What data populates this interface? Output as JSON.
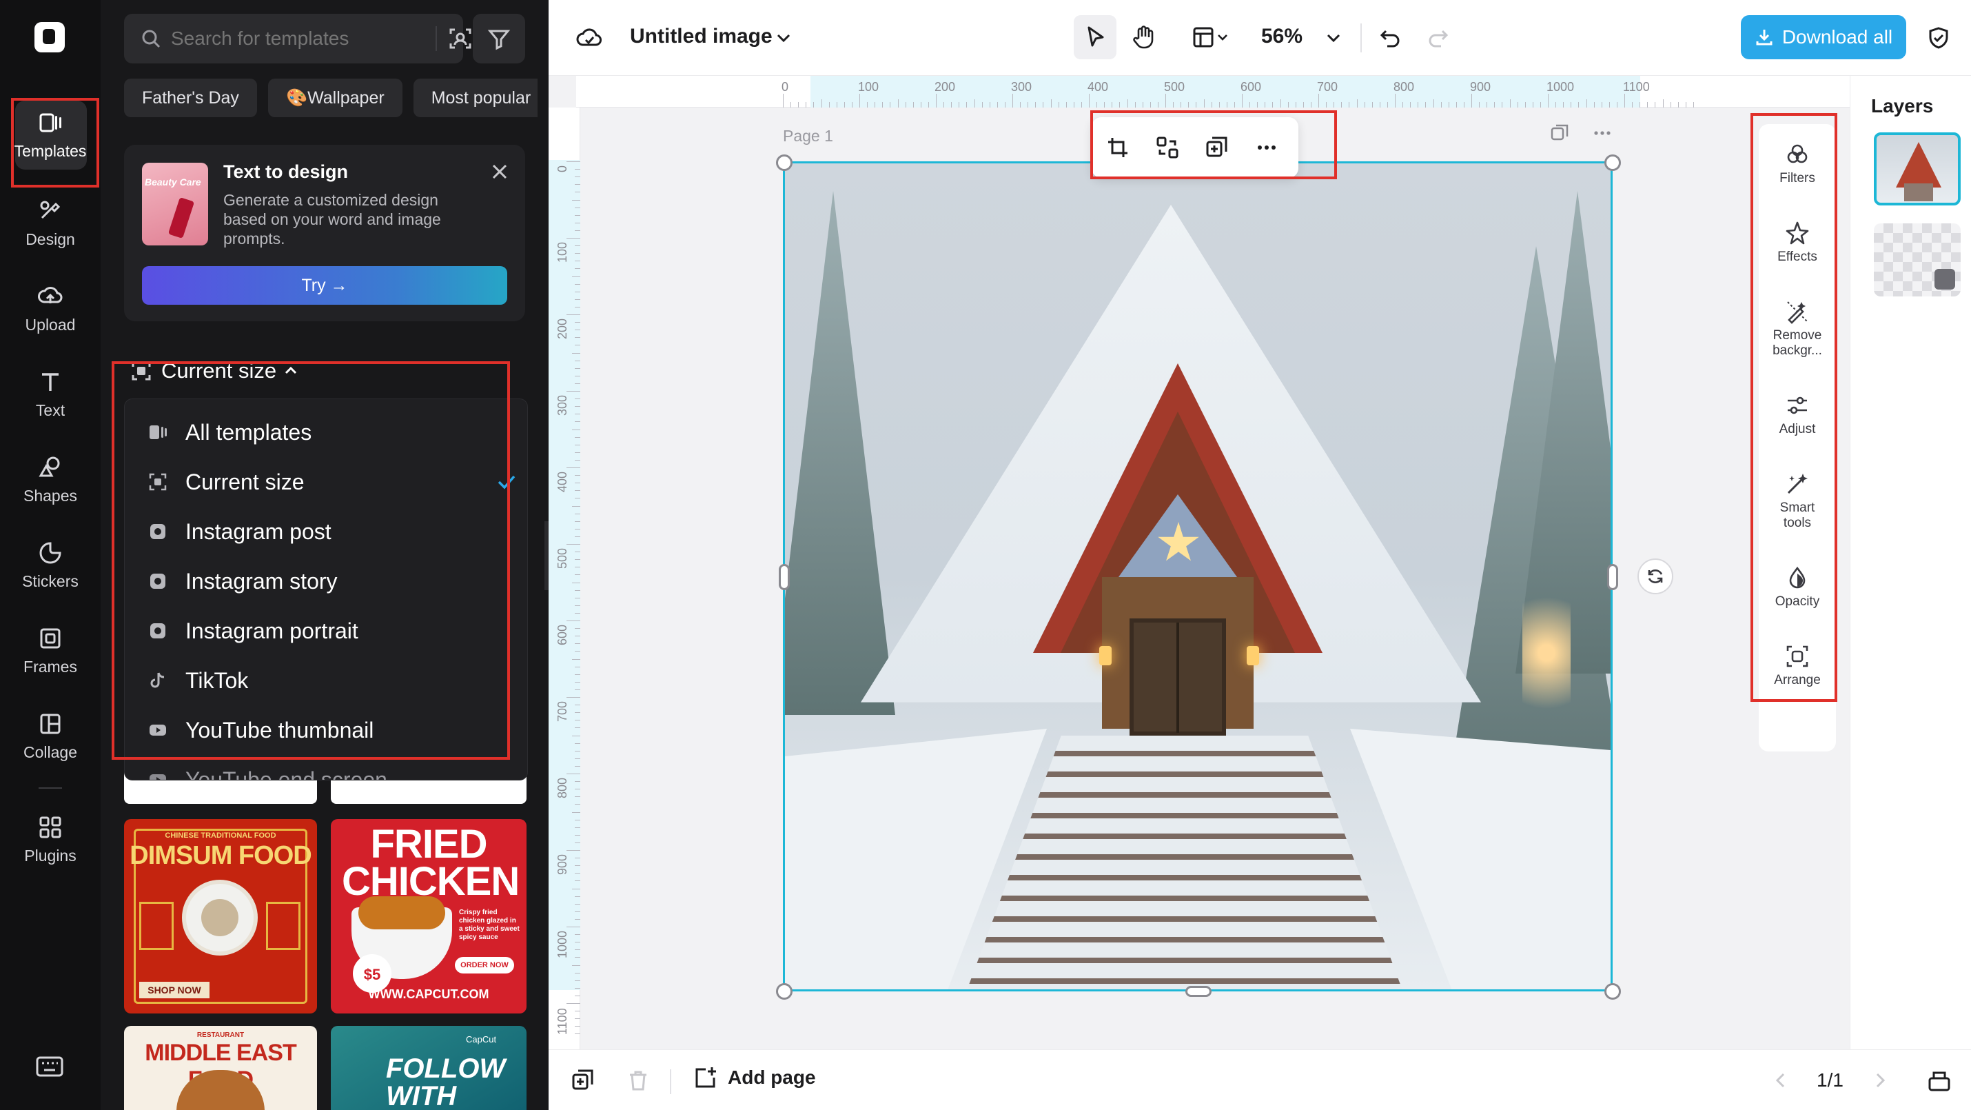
{
  "rail": {
    "items": [
      {
        "label": "Templates",
        "icon": "templates-icon",
        "active": true
      },
      {
        "label": "Design",
        "icon": "design-icon"
      },
      {
        "label": "Upload",
        "icon": "upload-icon"
      },
      {
        "label": "Text",
        "icon": "text-icon"
      },
      {
        "label": "Shapes",
        "icon": "shapes-icon"
      },
      {
        "label": "Stickers",
        "icon": "stickers-icon"
      },
      {
        "label": "Frames",
        "icon": "frames-icon"
      },
      {
        "label": "Collage",
        "icon": "collage-icon"
      },
      {
        "label": "Plugins",
        "icon": "plugins-icon"
      }
    ]
  },
  "panel": {
    "search_placeholder": "Search for templates",
    "chips": [
      "Father's Day",
      "🎨Wallpaper",
      "Most popular"
    ],
    "promo": {
      "thumb_text": "Beauty Care",
      "title": "Text to design",
      "description": "Generate a customized design based on your word and image prompts.",
      "button": "Try →"
    },
    "size_filter": "Current size",
    "dropdown": [
      {
        "label": "All templates",
        "icon": "all-templates-icon"
      },
      {
        "label": "Current size",
        "icon": "current-size-icon",
        "selected": true
      },
      {
        "label": "Instagram post",
        "icon": "instagram-icon"
      },
      {
        "label": "Instagram story",
        "icon": "instagram-icon"
      },
      {
        "label": "Instagram portrait",
        "icon": "instagram-icon"
      },
      {
        "label": "TikTok",
        "icon": "tiktok-icon"
      },
      {
        "label": "YouTube thumbnail",
        "icon": "youtube-icon"
      },
      {
        "label": "YouTube end screen",
        "icon": "youtube-icon"
      }
    ],
    "templates": {
      "dimsum_small": "CHINESE TRADITIONAL FOOD",
      "dimsum_title": "DIMSUM FOOD",
      "dimsum_cta": "SHOP NOW",
      "fried_title": "FRIED CHICKEN",
      "fried_price": "$5",
      "fried_desc": "Crispy fried chicken glazed in a sticky and sweet spicy sauce",
      "fried_cta": "ORDER NOW",
      "fried_url": "WWW.CAPCUT.COM",
      "mideast_small": "RESTAURANT",
      "mideast_title": "MIDDLE EAST FOOD",
      "follow_brand": "CapCut",
      "follow_title": "FOLLOW WITH"
    }
  },
  "topbar": {
    "title": "Untitled image",
    "zoom": "56%",
    "download": "Download all"
  },
  "canvas": {
    "page_label": "Page 1",
    "ruler_h": [
      "0",
      "100",
      "200",
      "300",
      "400",
      "500",
      "600",
      "700",
      "800",
      "900",
      "1000",
      "1100"
    ],
    "ruler_v": [
      "0",
      "100",
      "200",
      "300",
      "400",
      "500",
      "600",
      "700",
      "800",
      "900",
      "1000",
      "1100"
    ]
  },
  "tools": [
    {
      "label": "Filters",
      "icon": "filters-icon"
    },
    {
      "label": "Effects",
      "icon": "effects-icon"
    },
    {
      "label": "Remove backgr...",
      "icon": "remove-background-icon"
    },
    {
      "label": "Adjust",
      "icon": "adjust-icon"
    },
    {
      "label": "Smart tools",
      "icon": "smart-tools-icon"
    },
    {
      "label": "Opacity",
      "icon": "opacity-icon"
    },
    {
      "label": "Arrange",
      "icon": "arrange-icon"
    }
  ],
  "layers": {
    "title": "Layers"
  },
  "bottombar": {
    "add_page": "Add page",
    "pager": "1/1"
  },
  "colors": {
    "accent": "#2aa8e9",
    "selection": "#1db7d6",
    "highlight": "#e0302a"
  }
}
